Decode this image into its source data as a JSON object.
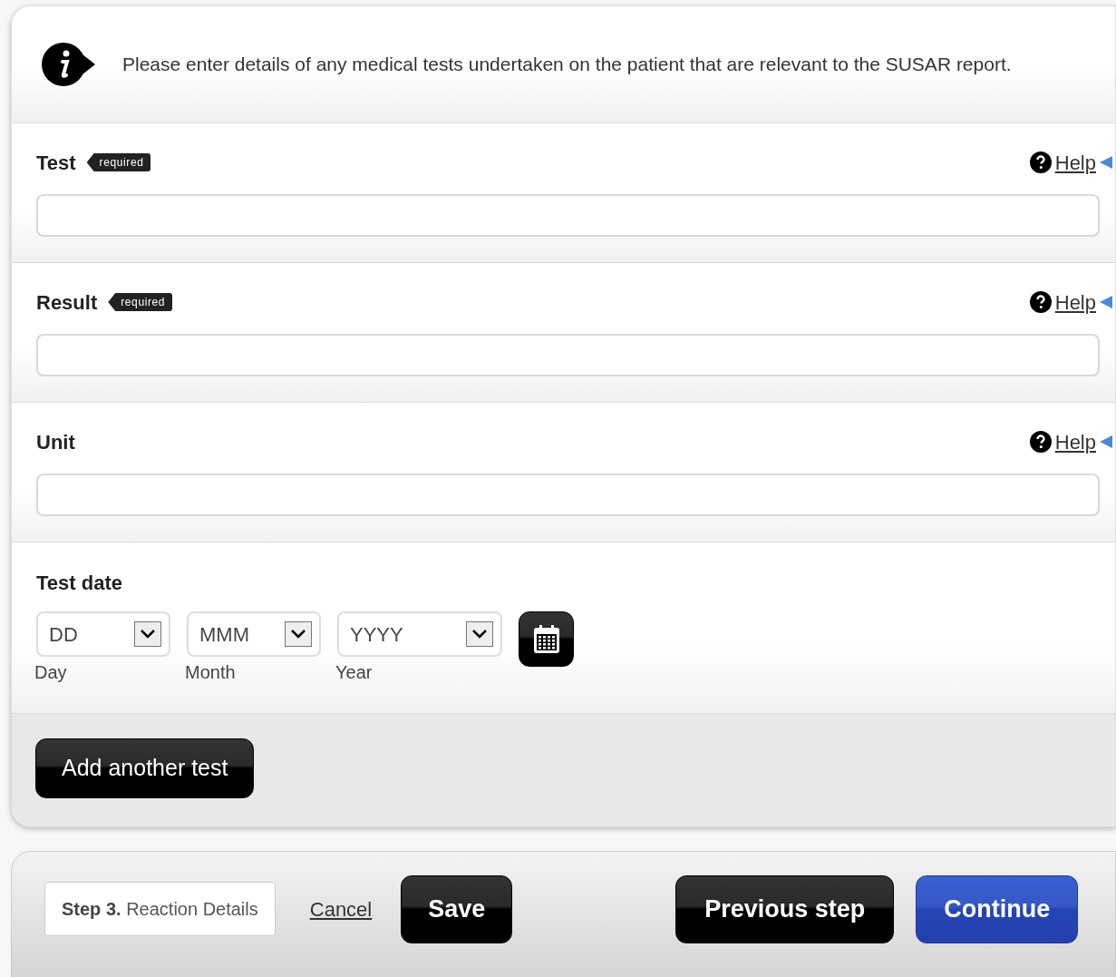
{
  "info": {
    "text": "Please enter details of any medical tests undertaken on the patient that are relevant to the SUSAR report."
  },
  "fields": [
    {
      "kind": "text",
      "label": "Test",
      "badge": "required",
      "help": "Help"
    },
    {
      "kind": "text",
      "label": "Result",
      "badge": "required",
      "help": "Help"
    },
    {
      "kind": "text",
      "label": "Unit",
      "help": "Help"
    },
    {
      "kind": "date",
      "label": "Test date",
      "parts": [
        {
          "placeholder": "DD",
          "caption": "Day"
        },
        {
          "placeholder": "MMM",
          "caption": "Month"
        },
        {
          "placeholder": "YYYY",
          "caption": "Year"
        }
      ]
    }
  ],
  "add_button": "Add another test",
  "footer": {
    "step": "**Step 3.** Reaction Details",
    "cancel": "Cancel",
    "save": "Save",
    "previous": "Previous step",
    "continue": "Continue"
  }
}
